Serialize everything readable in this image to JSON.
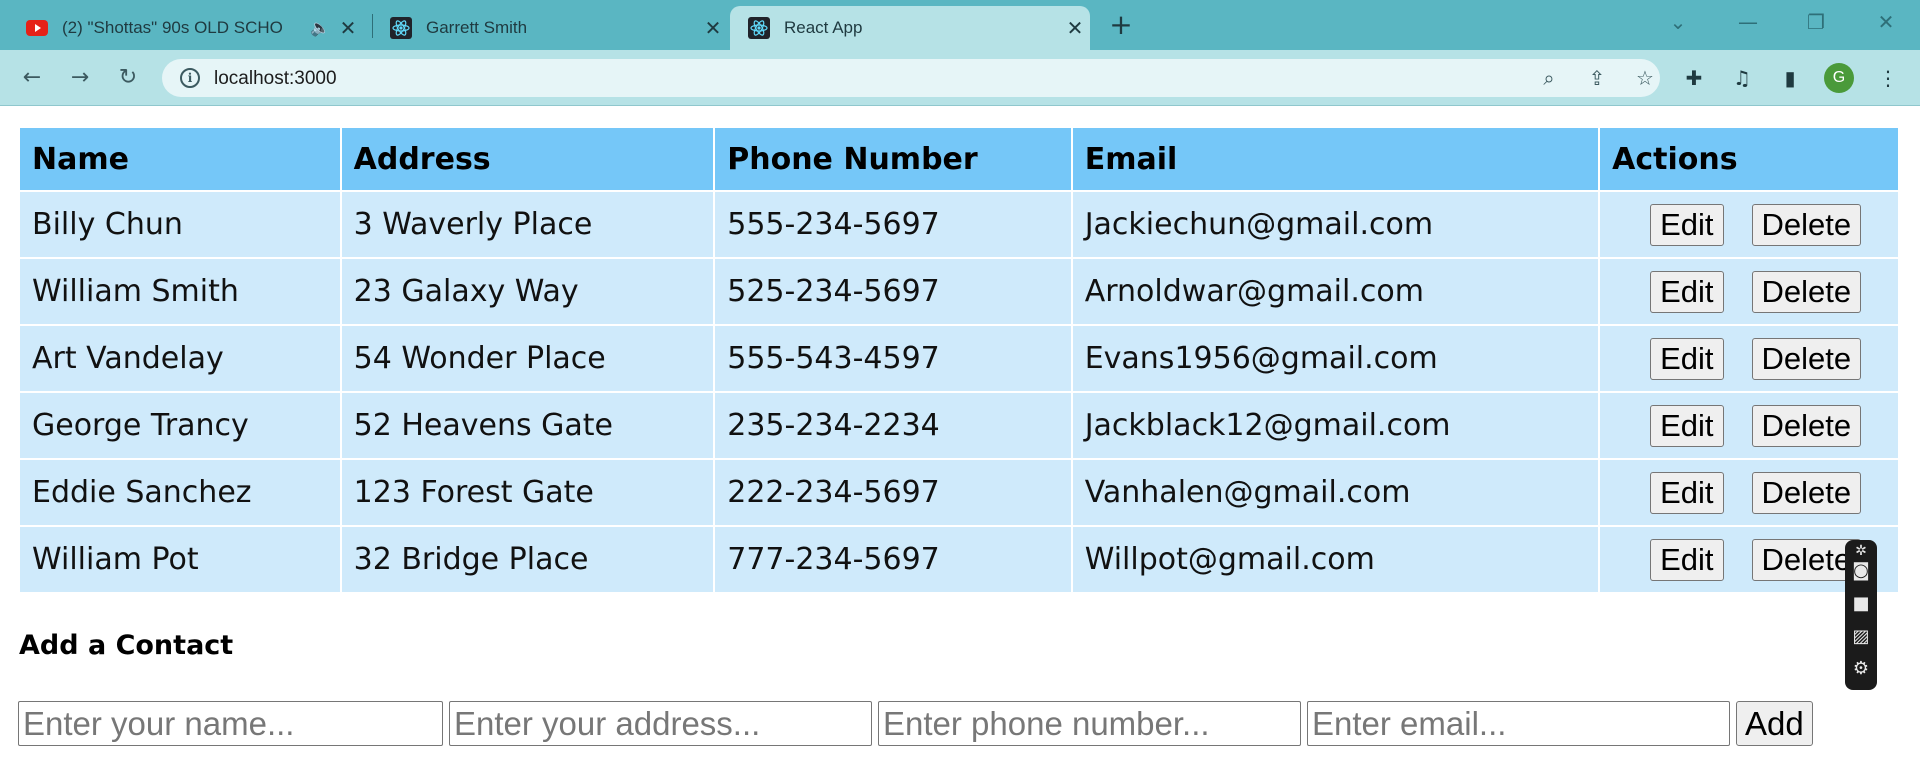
{
  "browser": {
    "tabs": [
      {
        "title": "(2) \"Shottas\" 90s OLD SCHO",
        "icon": "youtube-icon",
        "has_audio": true
      },
      {
        "title": "Garrett Smith",
        "icon": "react-icon"
      },
      {
        "title": "React App",
        "icon": "react-icon",
        "active": true
      }
    ],
    "new_tab_glyph": "+",
    "url": "localhost:3000",
    "profile_initial": "G",
    "accent": "#5ab6c2"
  },
  "table": {
    "headers": [
      "Name",
      "Address",
      "Phone Number",
      "Email",
      "Actions"
    ],
    "rows": [
      {
        "name": "Billy Chun",
        "address": "3 Waverly Place",
        "phone": "555-234-5697",
        "email": "Jackiechun@gmail.com"
      },
      {
        "name": "William Smith",
        "address": "23 Galaxy Way",
        "phone": "525-234-5697",
        "email": "Arnoldwar@gmail.com"
      },
      {
        "name": "Art Vandelay",
        "address": "54 Wonder Place",
        "phone": "555-543-4597",
        "email": "Evans1956@gmail.com"
      },
      {
        "name": "George Trancy",
        "address": "52 Heavens Gate",
        "phone": "235-234-2234",
        "email": "Jackblack12@gmail.com"
      },
      {
        "name": "Eddie Sanchez",
        "address": "123 Forest Gate",
        "phone": "222-234-5697",
        "email": "Vanhalen@gmail.com"
      },
      {
        "name": "William Pot",
        "address": "32 Bridge Place",
        "phone": "777-234-5697",
        "email": "Willpot@gmail.com"
      }
    ],
    "edit_label": "Edit",
    "delete_label": "Delete",
    "header_color": "#75c7f8",
    "row_color": "#cfeafb"
  },
  "form": {
    "title": "Add a Contact",
    "name_placeholder": "Enter your name...",
    "address_placeholder": "Enter your address...",
    "phone_placeholder": "Enter phone number...",
    "email_placeholder": "Enter email...",
    "add_label": "Add"
  }
}
